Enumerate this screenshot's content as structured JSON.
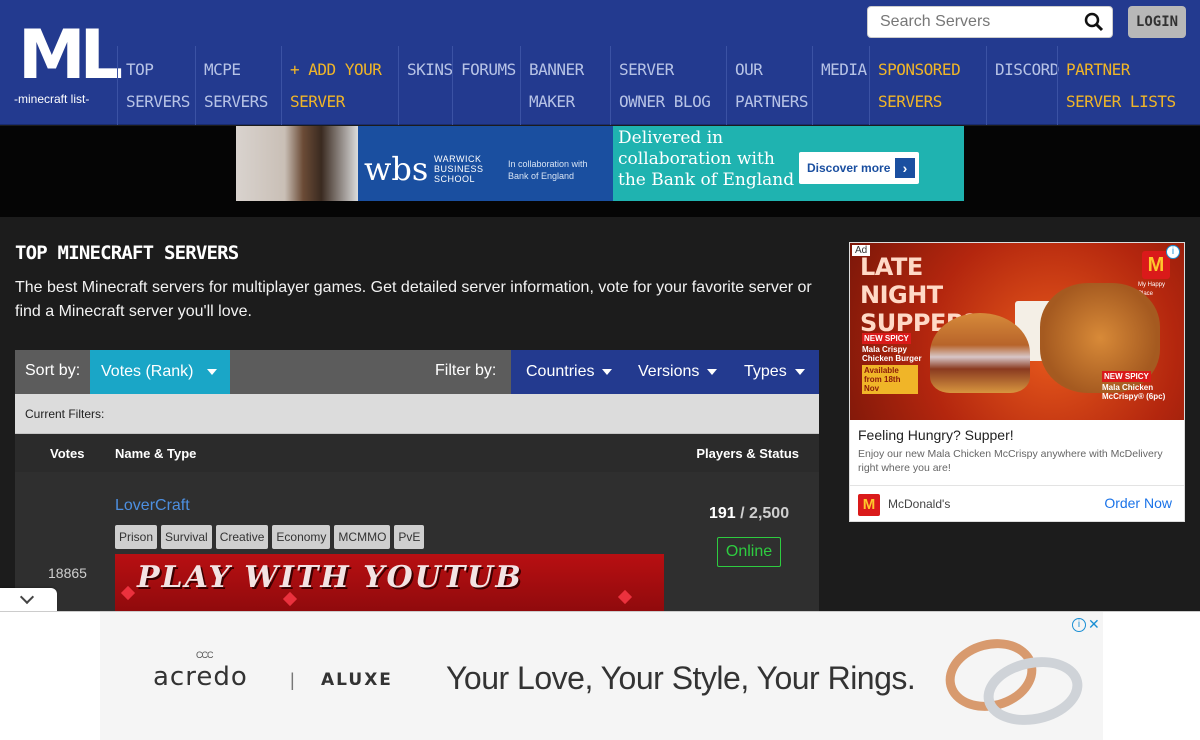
{
  "header": {
    "logo_text": "ML",
    "logo_subtitle": "-minecraft list-",
    "search_placeholder": "Search Servers",
    "login_label": "LOGIN",
    "nav": [
      {
        "label": "TOP SERVERS"
      },
      {
        "label": "MCPE SERVERS"
      },
      {
        "label": "ADD YOUR SERVER",
        "prefix": "+"
      },
      {
        "label": "SKINS"
      },
      {
        "label": "FORUMS"
      },
      {
        "label": "BANNER MAKER"
      },
      {
        "label": "SERVER OWNER BLOG"
      },
      {
        "label": "OUR PARTNERS"
      },
      {
        "label": "MEDIA"
      },
      {
        "label": "SPONSORED SERVERS"
      },
      {
        "label": "DISCORD"
      },
      {
        "label": "PARTNER SERVER LISTS"
      }
    ]
  },
  "top_ad": {
    "brand": "wbs",
    "brand_name": "WARWICK BUSINESS SCHOOL",
    "collab_text": "In collaboration with Bank of England",
    "headline": "Delivered in collaboration with the Bank of England",
    "cta": "Discover more"
  },
  "main": {
    "title": "TOP MINECRAFT SERVERS",
    "description": "The best Minecraft servers for multiplayer games. Get detailed server information, vote for your favorite server or find a Minecraft server you'll love.",
    "sort_label": "Sort by:",
    "sort_value": "Votes (Rank)",
    "filter_label": "Filter by:",
    "filters": [
      "Countries",
      "Versions",
      "Types"
    ],
    "current_filters_label": "Current Filters:",
    "columns": {
      "votes": "Votes",
      "name": "Name & Type",
      "players": "Players & Status"
    },
    "servers": [
      {
        "votes": "18865",
        "name": "LoverCraft",
        "tags": [
          "Prison",
          "Survival",
          "Creative",
          "Economy",
          "MCMMO",
          "PvE"
        ],
        "banner_text": "PLAY WITH YOUTUB",
        "players_online": "191",
        "players_max": "2,500",
        "status": "Online"
      }
    ]
  },
  "side_ad": {
    "ad_label": "Ad",
    "headline": "LATE NIGHT SUPPER?",
    "badge_text": "M",
    "tagline_small": "My Happy Place",
    "burger_label": "Mala Crispy Chicken Burger",
    "burger_tag": "NEW SPICY",
    "available": "Available from 18th Nov",
    "chicken_label": "Mala Chicken McCrispy® (6pc)",
    "chicken_tag": "NEW SPICY",
    "title": "Feeling Hungry? Supper!",
    "body": "Enjoy our new Mala Chicken McCrispy anywhere with McDelivery right where you are!",
    "advertiser": "McDonald's",
    "cta": "Order Now"
  },
  "bottom_ad": {
    "brand1": "acredo",
    "brand1_mark": "CCC",
    "separator": "|",
    "brand2": "ALUXE",
    "tagline": "Your Love, Your Style, Your Rings."
  }
}
